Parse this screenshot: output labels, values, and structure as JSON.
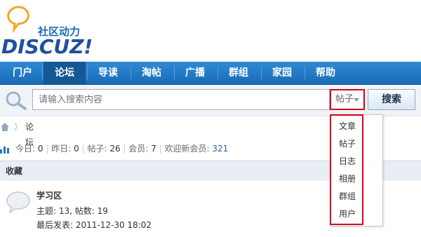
{
  "logo": {
    "tagline": "社区动力",
    "wordmark": "DISCUZ!"
  },
  "nav": {
    "items": [
      "门户",
      "论坛",
      "导读",
      "淘帖",
      "广播",
      "群组",
      "家园",
      "帮助"
    ],
    "active": "论坛"
  },
  "search": {
    "placeholder": "请输入搜索内容",
    "scope": "帖子",
    "button": "搜索",
    "options": [
      "文章",
      "帖子",
      "日志",
      "相册",
      "群组",
      "用户"
    ]
  },
  "breadcrumb": {
    "sep": "〉",
    "current": "论坛"
  },
  "stats": {
    "today_label": "今日:",
    "today": "0",
    "yesterday_label": "昨日:",
    "yesterday": "0",
    "posts_label": "帖子:",
    "posts": "26",
    "members_label": "会员:",
    "members": "7",
    "welcome_label": "欢迎新会员:",
    "new_member": "321"
  },
  "section": {
    "title": "收藏"
  },
  "forum": {
    "name": "学习区",
    "meta": "主题: 13, 帖数: 19",
    "last_post": "最后发表: 2011-12-30 18:02"
  },
  "colors": {
    "nav": "#1a6bb6",
    "highlight": "#d7001a"
  }
}
